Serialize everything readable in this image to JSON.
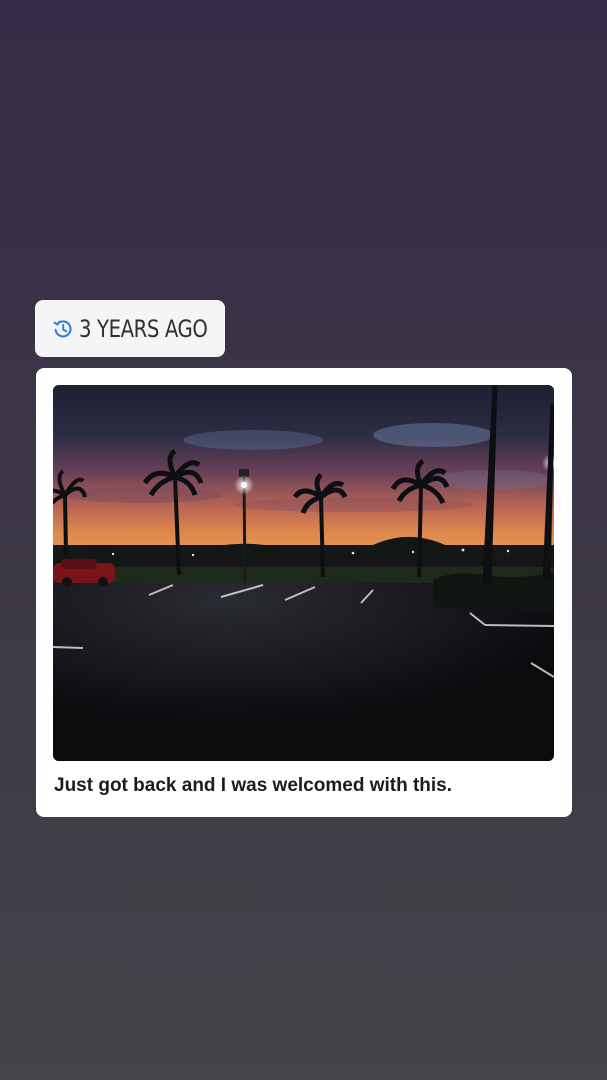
{
  "memory": {
    "time_label": "3 YEARS AGO",
    "icon": "clock-history-icon",
    "accent_color": "#2d7be5"
  },
  "post": {
    "caption": "Just got back and I was welcomed with this."
  },
  "colors": {
    "background_top": "#352c47",
    "background_bottom": "#444348",
    "card": "#ffffff",
    "badge": "#f4f5f7"
  }
}
